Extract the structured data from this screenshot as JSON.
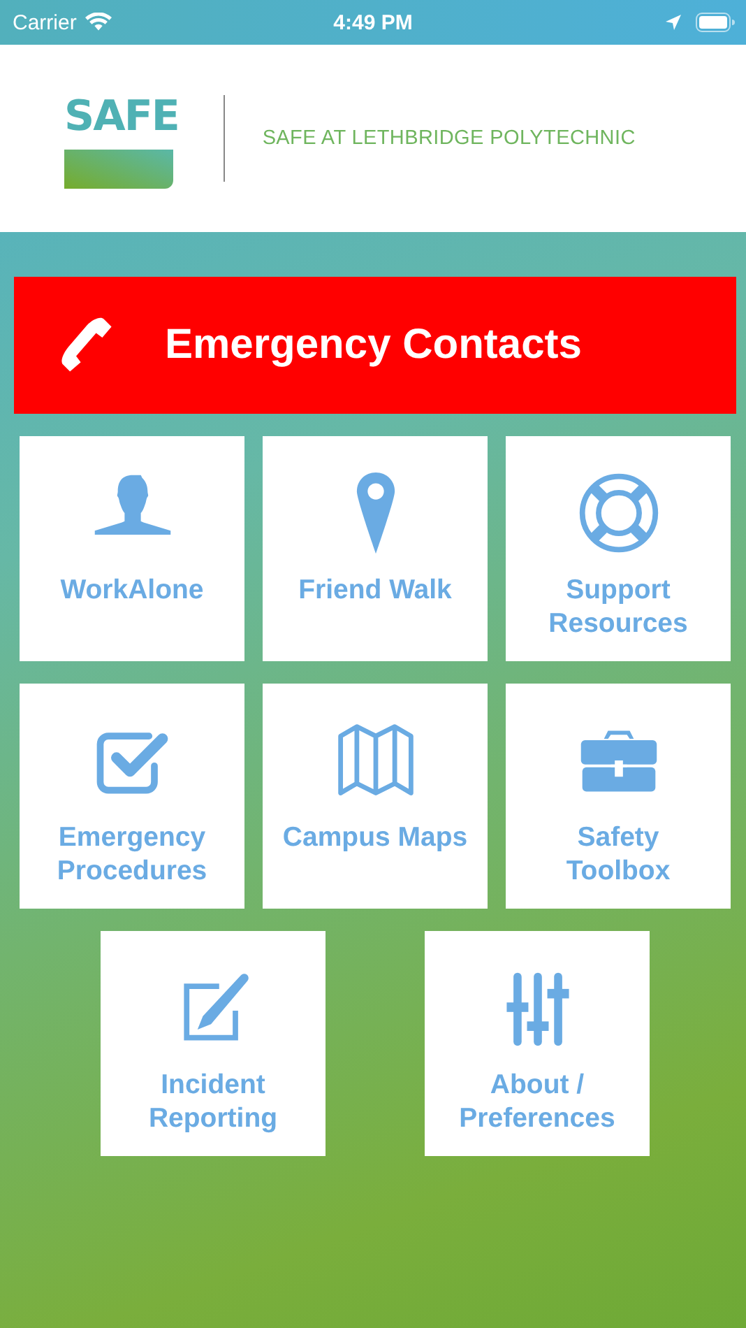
{
  "status_bar": {
    "carrier": "Carrier",
    "time": "4:49 PM"
  },
  "header": {
    "logo": "SAFE",
    "tagline": "SAFE AT LETHBRIDGE POLYTECHNIC"
  },
  "emergency_button": {
    "label": "Emergency Contacts"
  },
  "tile_rows": [
    {
      "tiles": [
        {
          "label": "WorkAlone",
          "kind": "person"
        },
        {
          "label": "Friend Walk",
          "kind": "pin"
        },
        {
          "label": "Support Resources",
          "kind": "lifebuoy"
        }
      ]
    },
    {
      "tiles": [
        {
          "label": "Emergency Procedures",
          "kind": "checkbox"
        },
        {
          "label": "Campus Maps",
          "kind": "map"
        },
        {
          "label": "Safety Toolbox",
          "kind": "toolbox"
        }
      ]
    },
    {
      "tiles": [
        {
          "label": "Incident Reporting",
          "kind": "pencil"
        },
        {
          "label": "About / Preferences",
          "kind": "sliders"
        }
      ]
    }
  ]
}
